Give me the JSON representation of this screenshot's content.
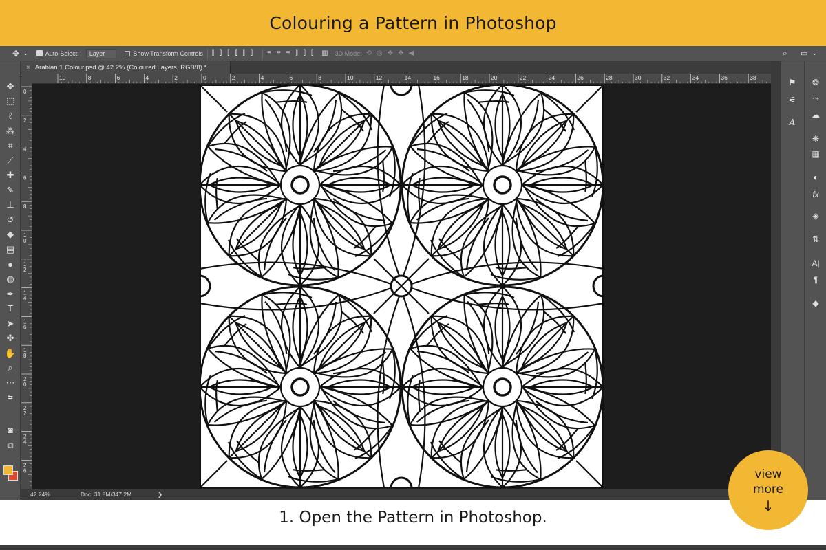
{
  "banner": {
    "title": "Colouring a Pattern in Photoshop"
  },
  "options_bar": {
    "auto_select_label": "Auto-Select:",
    "auto_select_value": "Layer",
    "transform_label": "Show Transform Controls",
    "mode_3d_label": "3D Mode:"
  },
  "document": {
    "tab_title": "Arabian 1 Colour.psd @ 42.2% (Coloured Layers, RGB/8) *"
  },
  "ruler": {
    "h_labels": [
      "10",
      "8",
      "6",
      "4",
      "2",
      "0",
      "2",
      "4",
      "6",
      "8",
      "10",
      "12",
      "14",
      "16",
      "18",
      "20",
      "22",
      "24",
      "26",
      "28",
      "30",
      "32",
      "34",
      "36",
      "38"
    ],
    "v_labels": [
      "0",
      "2",
      "4",
      "6",
      "8",
      "1 0",
      "1 2",
      "1 4",
      "1 6",
      "1 8",
      "2 0",
      "2 2",
      "2 4",
      "2 6"
    ]
  },
  "status": {
    "zoom": "42.24%",
    "doc_size": "Doc: 31.8M/347.2M",
    "arrow": "❯"
  },
  "colors": {
    "foreground": "#f2b733",
    "background": "#d9492b",
    "accent": "#f2b733"
  },
  "caption": {
    "text": "1. Open the Pattern in Photoshop."
  },
  "view_more": {
    "line1": "view",
    "line2": "more",
    "arrow": "↓"
  }
}
